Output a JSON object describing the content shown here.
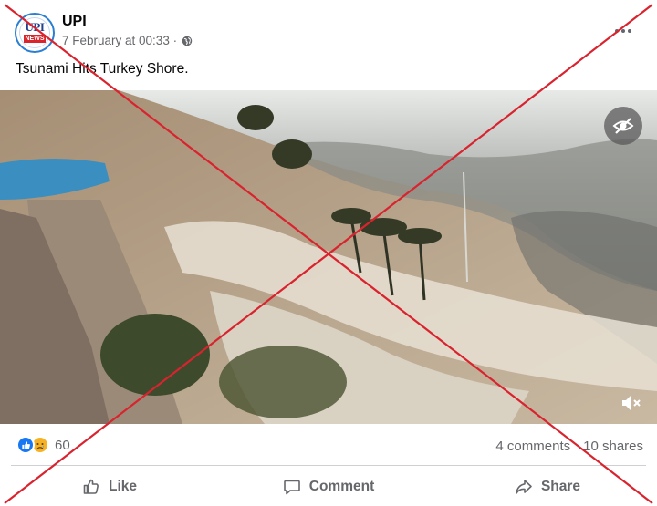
{
  "post": {
    "page_name": "UPI",
    "avatar_text_top": "UPI",
    "avatar_text_bottom": "NEWS",
    "timestamp": "7 February at 00:33 ·",
    "text": "Tsunami Hits Turkey Shore."
  },
  "media": {
    "type": "video",
    "hide_icon": "eye-slash-icon",
    "mute_icon": "speaker-muted-icon"
  },
  "stats": {
    "reaction_count": "60",
    "comments": "4 comments",
    "shares": "10 shares"
  },
  "actions": {
    "like": "Like",
    "comment": "Comment",
    "share": "Share"
  },
  "colors": {
    "facebook_blue": "#1877f2",
    "cross_red": "#d9232e",
    "secondary_text": "#65676b"
  }
}
